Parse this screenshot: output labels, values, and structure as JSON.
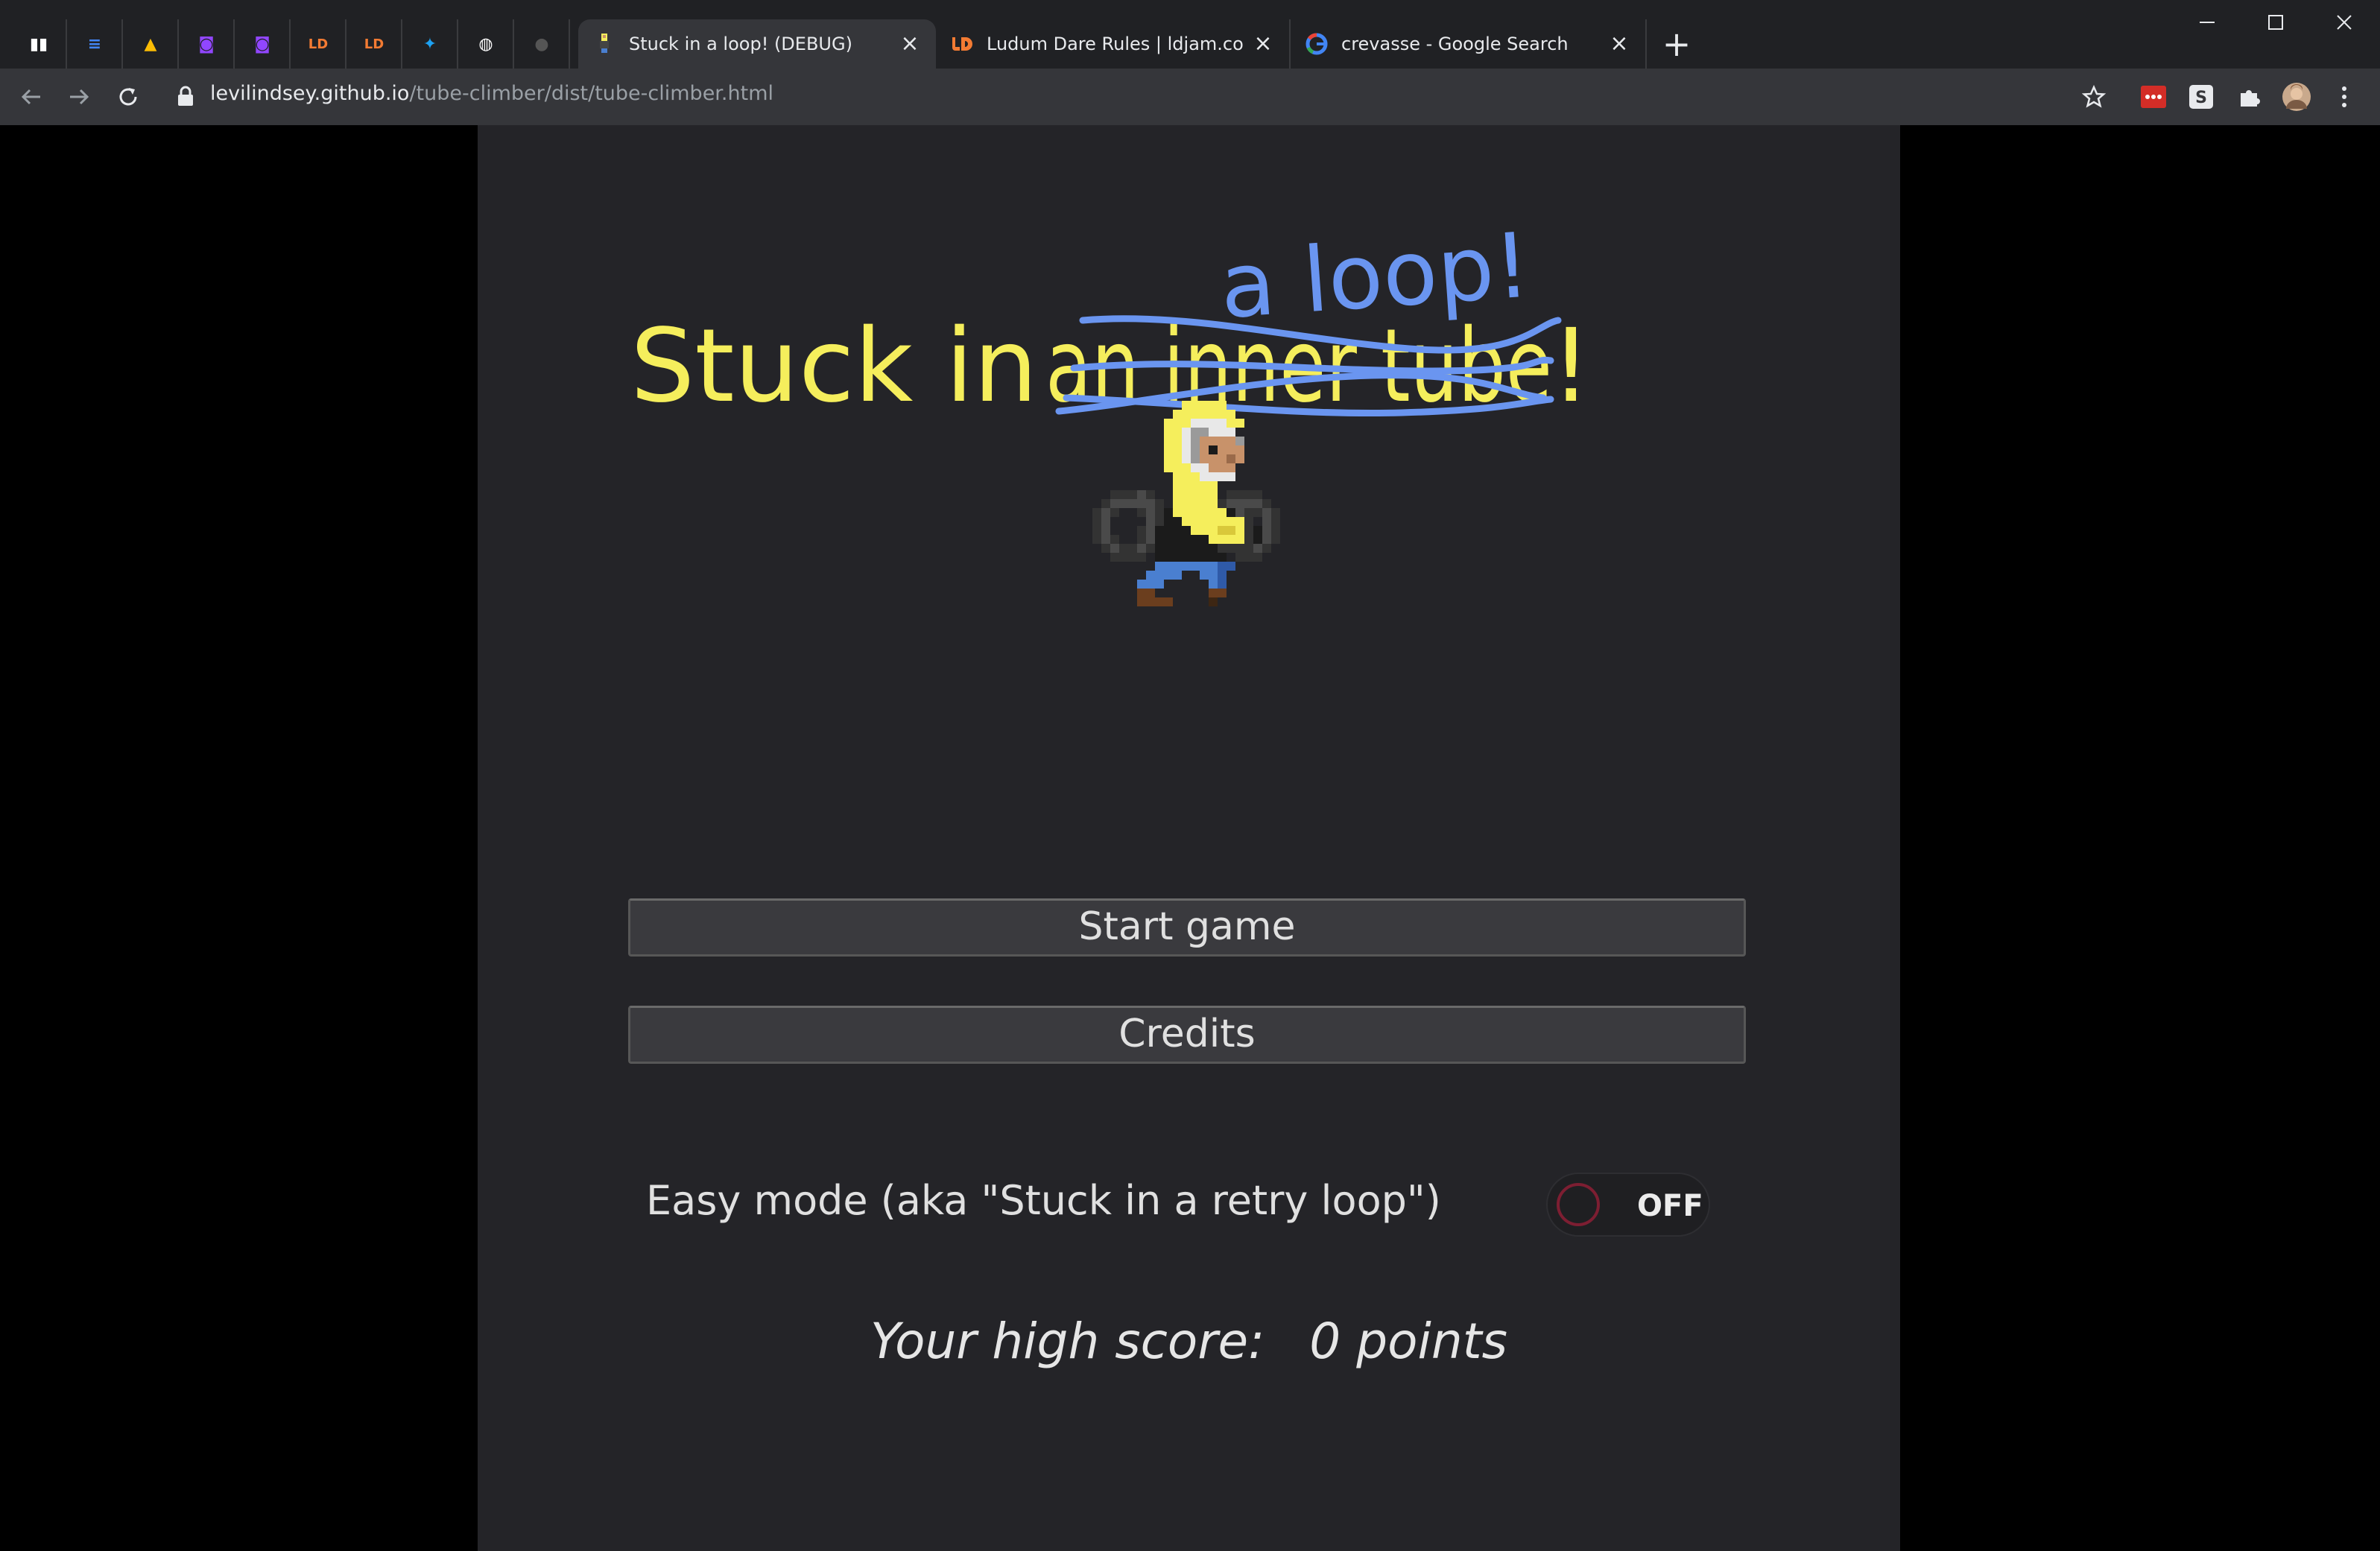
{
  "browser": {
    "pinned_tabs": [
      {
        "icon": "trello-icon",
        "color": "#ffffff"
      },
      {
        "icon": "google-docs-icon",
        "color": "#4285f4"
      },
      {
        "icon": "google-drive-icon",
        "color": "#fbbc04"
      },
      {
        "icon": "twitch-icon",
        "color": "#9146ff"
      },
      {
        "icon": "twitch-icon",
        "color": "#9146ff"
      },
      {
        "icon": "ludum-dare-icon",
        "color": "#f37b33"
      },
      {
        "icon": "ludum-dare-icon",
        "color": "#f37b33"
      },
      {
        "icon": "twitter-icon",
        "color": "#1da1f2"
      },
      {
        "icon": "globe-icon",
        "color": "#ffffff"
      },
      {
        "icon": "github-icon",
        "color": "#555555"
      }
    ],
    "tabs": [
      {
        "title": "Stuck in a loop! (DEBUG)",
        "icon": "game-favicon-icon",
        "active": true
      },
      {
        "title": "Ludum Dare Rules | ldjam.com | L",
        "icon": "ludum-dare-icon",
        "active": false
      },
      {
        "title": "crevasse - Google Search",
        "icon": "google-icon",
        "active": false
      }
    ],
    "url_host": "levilindsey.github.io",
    "url_path": "/tube-climber/dist/tube-climber.html"
  },
  "game": {
    "title_main": "Stuck in",
    "title_struck": "an inner tube",
    "title_end": "!",
    "title_correction": "a loop!",
    "colors": {
      "title_yellow": "#f5ee5c",
      "scribble_blue": "#6a95f0",
      "panel_bg": "#242428"
    },
    "start_button": "Start game",
    "credits_button": "Credits",
    "easy_mode_label": "Easy mode (aka \"Stuck in a retry loop\")",
    "easy_mode_state": "OFF",
    "high_score_label": "Your high score:",
    "high_score_value": "0 points"
  }
}
